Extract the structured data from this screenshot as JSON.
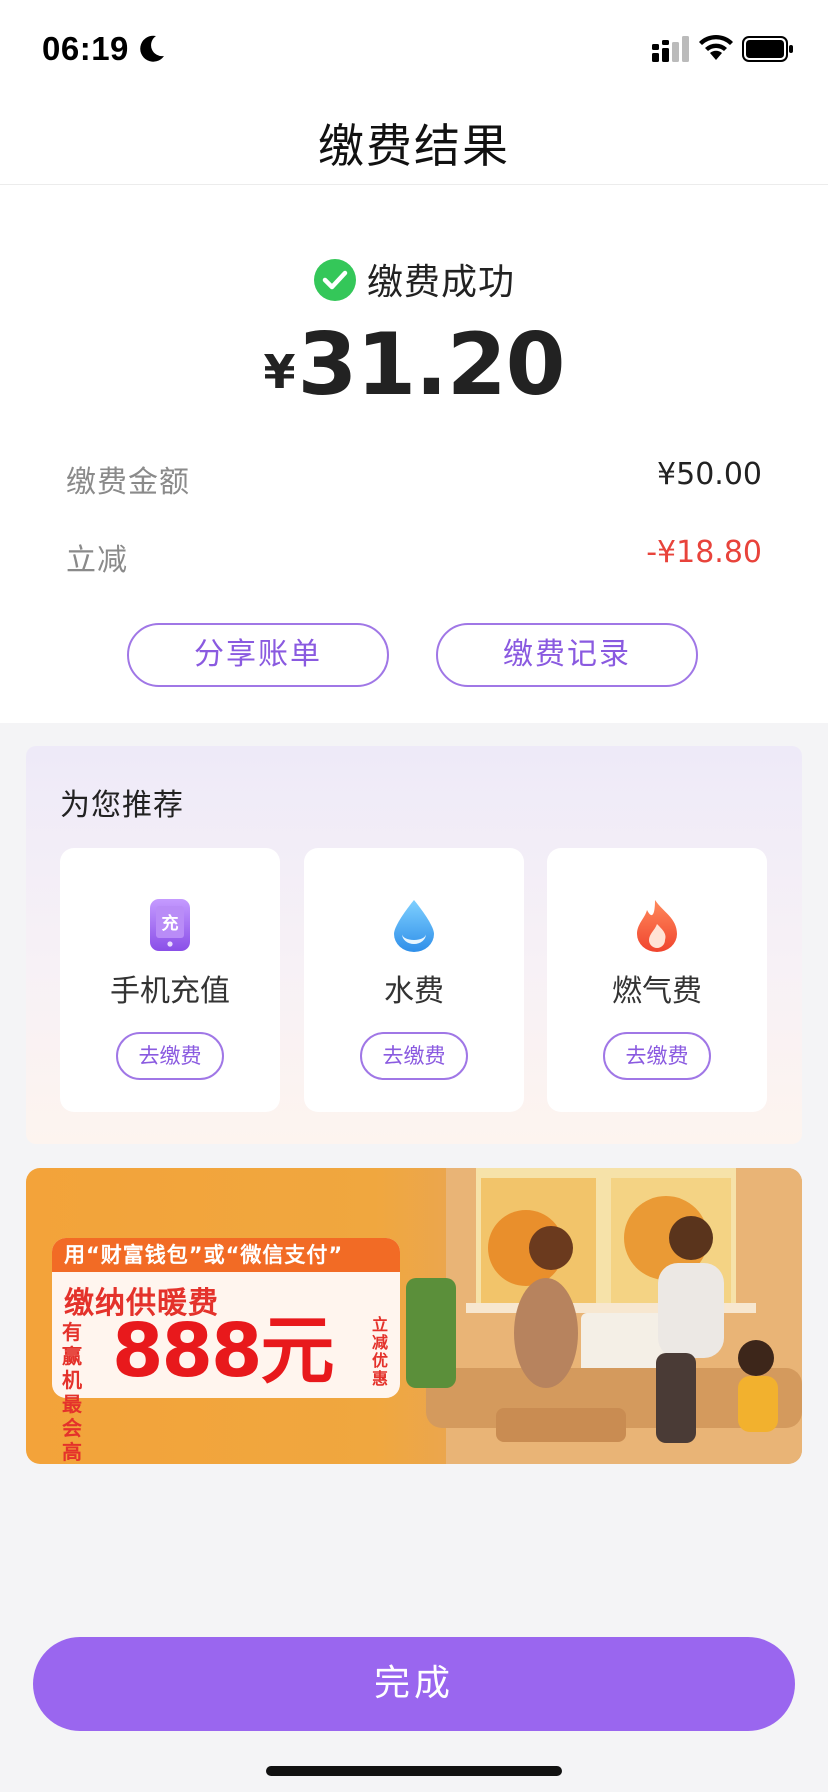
{
  "status_bar": {
    "time": "06:19"
  },
  "nav": {
    "title": "缴费结果"
  },
  "result": {
    "status_text": "缴费成功",
    "currency": "¥",
    "amount": "31.20",
    "rows": [
      {
        "label": "缴费金额",
        "value": "¥50.00"
      },
      {
        "label": "立减",
        "value": "-¥18.80"
      }
    ],
    "share_label": "分享账单",
    "records_label": "缴费记录"
  },
  "recommend": {
    "title": "为您推荐",
    "items": [
      {
        "label": "手机充值",
        "button": "去缴费",
        "icon": "phone-recharge-icon",
        "icon_text": "充"
      },
      {
        "label": "水费",
        "button": "去缴费",
        "icon": "water-drop-icon"
      },
      {
        "label": "燃气费",
        "button": "去缴费",
        "icon": "flame-icon"
      }
    ]
  },
  "banner": {
    "tag": "用“财富钱包”或“微信支付”",
    "heading": "缴纳供暖费",
    "side": "有赢机最会高",
    "big": "888元",
    "vertical": "立减优惠"
  },
  "footer": {
    "done_label": "完成"
  },
  "colors": {
    "accent": "#9a66ef",
    "success": "#34c759",
    "discount": "#e8433b"
  }
}
